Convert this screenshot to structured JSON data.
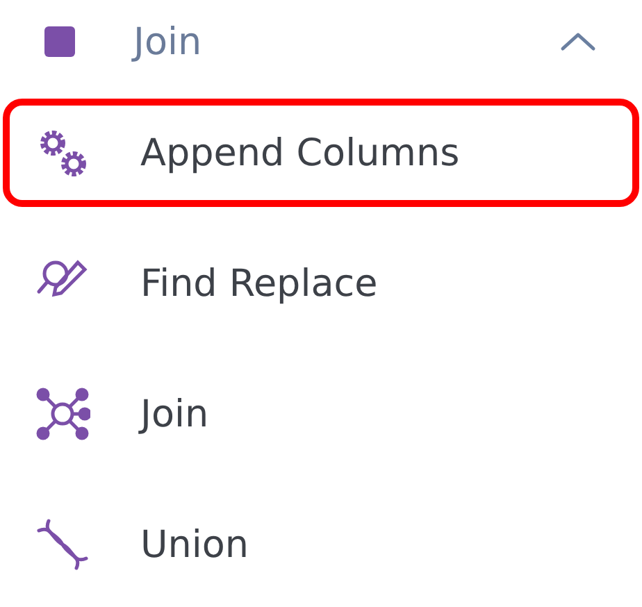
{
  "section": {
    "title": "Join",
    "expanded": true
  },
  "items": [
    {
      "label": "Append Columns",
      "highlighted": true
    },
    {
      "label": "Find Replace",
      "highlighted": false
    },
    {
      "label": "Join",
      "highlighted": false
    },
    {
      "label": "Union",
      "highlighted": false
    }
  ]
}
